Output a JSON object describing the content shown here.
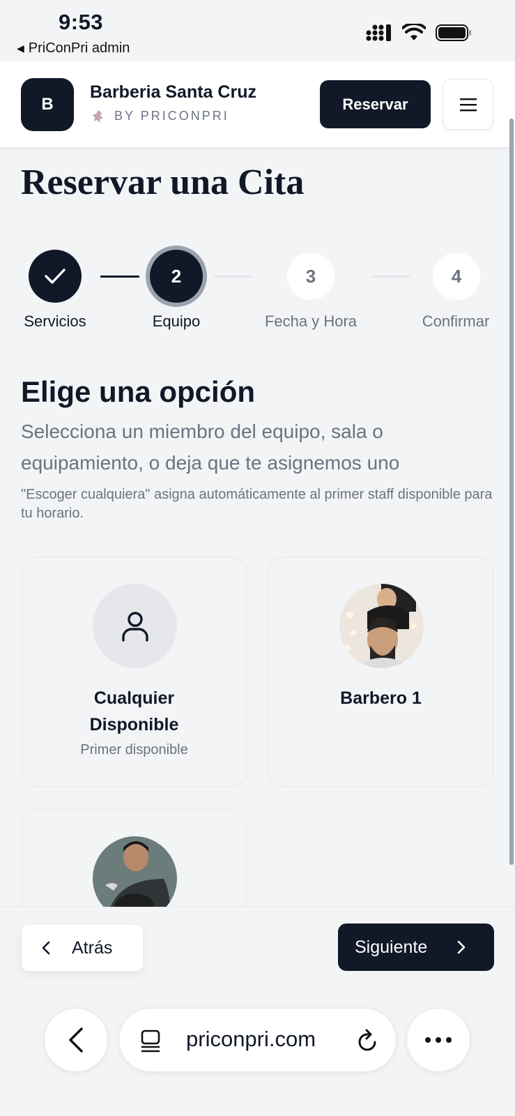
{
  "status_bar": {
    "time": "9:53",
    "back_app": "PriConPri admin"
  },
  "header": {
    "logo_letter": "B",
    "business_name": "Barberia Santa Cruz",
    "byline": "BY PRICONPRI",
    "reserve_button": "Reservar",
    "menu_icon": "menu-icon"
  },
  "page": {
    "title": "Reservar una Cita"
  },
  "stepper": {
    "steps": [
      {
        "number": "",
        "label": "Servicios",
        "state": "done"
      },
      {
        "number": "2",
        "label": "Equipo",
        "state": "current"
      },
      {
        "number": "3",
        "label": "Fecha y Hora",
        "state": "upcoming"
      },
      {
        "number": "4",
        "label": "Confirmar",
        "state": "upcoming"
      }
    ]
  },
  "section": {
    "title": "Elige una opción",
    "subtitle": "Selecciona un miembro del equipo, sala o equipamiento, o deja que te asignemos uno",
    "note": "\"Escoger cualquiera\" asigna automáticamente al primer staff disponible para tu horario."
  },
  "options": [
    {
      "name": "Cualquier Disponible",
      "sub": "Primer disponible",
      "icon": "user-icon"
    },
    {
      "name": "Barbero 1",
      "sub": ""
    },
    {
      "name": "",
      "sub": ""
    }
  ],
  "footer": {
    "back_label": "Atrás",
    "next_label": "Siguiente"
  },
  "browser": {
    "url": "priconpri.com"
  },
  "colors": {
    "primary": "#111827",
    "muted": "#6b7280",
    "background": "#f3f4f6",
    "card_border": "#e5e7eb"
  }
}
